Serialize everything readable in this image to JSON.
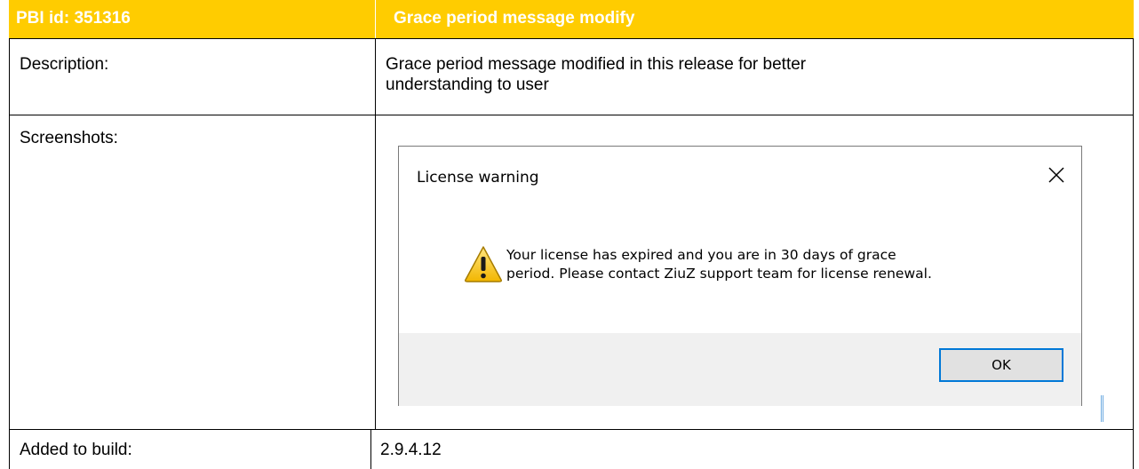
{
  "header": {
    "id_label": "PBI id: 351316",
    "title": "Grace period message modify"
  },
  "rows": {
    "description_label": "Description:",
    "description_line1": "Grace period message modified in this release for better",
    "description_line2": "understanding to user",
    "screenshots_label": "Screenshots:",
    "build_label": "Added to build:",
    "build_value": "2.9.4.12"
  },
  "dialog": {
    "title": "License warning",
    "close_icon": "close-icon",
    "warning_icon": "warning-icon",
    "message_line1": "Your license has expired and you are in 30 days of grace",
    "message_line2": "period. Please contact ZiuZ support team for license renewal.",
    "ok_label": "OK"
  },
  "colors": {
    "header_bg": "#ffcc00",
    "header_text": "#ffffff",
    "dialog_footer_bg": "#f0f0f0",
    "focus_border": "#0078d7"
  }
}
